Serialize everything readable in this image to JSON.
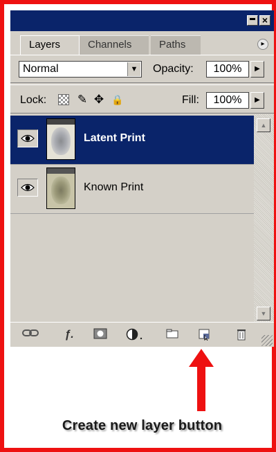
{
  "tabs": [
    {
      "label": "Layers",
      "active": true
    },
    {
      "label": "Channels",
      "active": false
    },
    {
      "label": "Paths",
      "active": false
    }
  ],
  "blend_mode": "Normal",
  "opacity": {
    "label": "Opacity:",
    "value": "100%"
  },
  "lock": {
    "label": "Lock:"
  },
  "fill": {
    "label": "Fill:",
    "value": "100%"
  },
  "layers": [
    {
      "name": "Latent Print",
      "selected": true,
      "visible": true
    },
    {
      "name": "Known Print",
      "selected": false,
      "visible": true
    }
  ],
  "bottom_icons": [
    "link-icon",
    "layer-style-icon",
    "layer-mask-icon",
    "adjustment-layer-icon",
    "folder-icon",
    "new-layer-icon",
    "trash-icon"
  ],
  "annotation": "Create new layer button",
  "colors": {
    "frame": "#ee1111",
    "titlebar": "#0a246a",
    "panel": "#d4d0c8",
    "arrow": "#ee1111"
  }
}
